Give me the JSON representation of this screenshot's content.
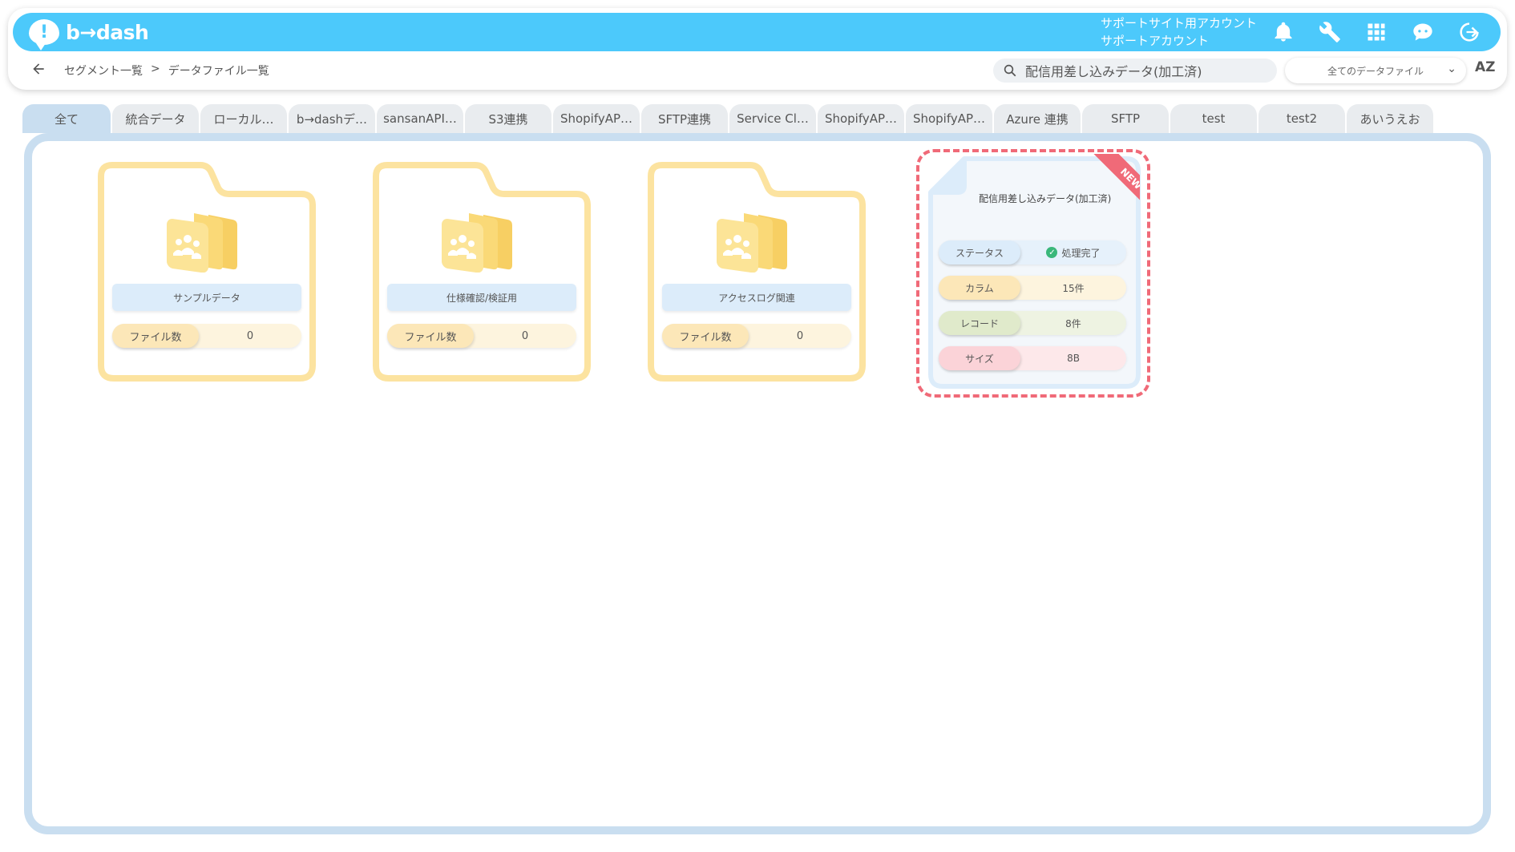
{
  "app": {
    "logo_text": "b→dash",
    "account_line1": "サポートサイト用アカウント",
    "account_line2": "サポートアカウント"
  },
  "breadcrumb": {
    "back_icon": "arrow-left-icon",
    "item1": "セグメント一覧",
    "separator": ">",
    "item2": "データファイル一覧"
  },
  "search": {
    "value": "配信用差し込みデータ(加工済)"
  },
  "filter": {
    "selected": "全てのデータファイル"
  },
  "sort": {
    "label": "AZ"
  },
  "tabs": [
    {
      "label": "全て"
    },
    {
      "label": "統合データ"
    },
    {
      "label": "ローカル…"
    },
    {
      "label": "b→dashデ…"
    },
    {
      "label": "sansanAPI…"
    },
    {
      "label": "S3連携"
    },
    {
      "label": "ShopifyAP…"
    },
    {
      "label": "SFTP連携"
    },
    {
      "label": "Service Cl…"
    },
    {
      "label": "ShopifyAP…"
    },
    {
      "label": "ShopifyAP…"
    },
    {
      "label": "Azure 連携"
    },
    {
      "label": "SFTP"
    },
    {
      "label": "test"
    },
    {
      "label": "test2"
    },
    {
      "label": "あいうえお"
    }
  ],
  "folders": [
    {
      "name": "サンプルデータ",
      "count_label": "ファイル数",
      "count": "0"
    },
    {
      "name": "仕様確認/検証用",
      "count_label": "ファイル数",
      "count": "0"
    },
    {
      "name": "アクセスログ関連",
      "count_label": "ファイル数",
      "count": "0"
    }
  ],
  "file": {
    "badge": "NEW",
    "title": "配信用差し込みデータ(加工済)",
    "status_label": "ステータス",
    "status_value": "処理完了",
    "column_label": "カラム",
    "column_value": "15件",
    "record_label": "レコード",
    "record_value": "8件",
    "size_label": "サイズ",
    "size_value": "8B"
  },
  "colors": {
    "topbar": "#4cc9fb",
    "tab_active": "#c9def0",
    "folder_border": "#fce3a0",
    "new_badge": "#f06a78",
    "status_ok": "#3ab77a"
  }
}
